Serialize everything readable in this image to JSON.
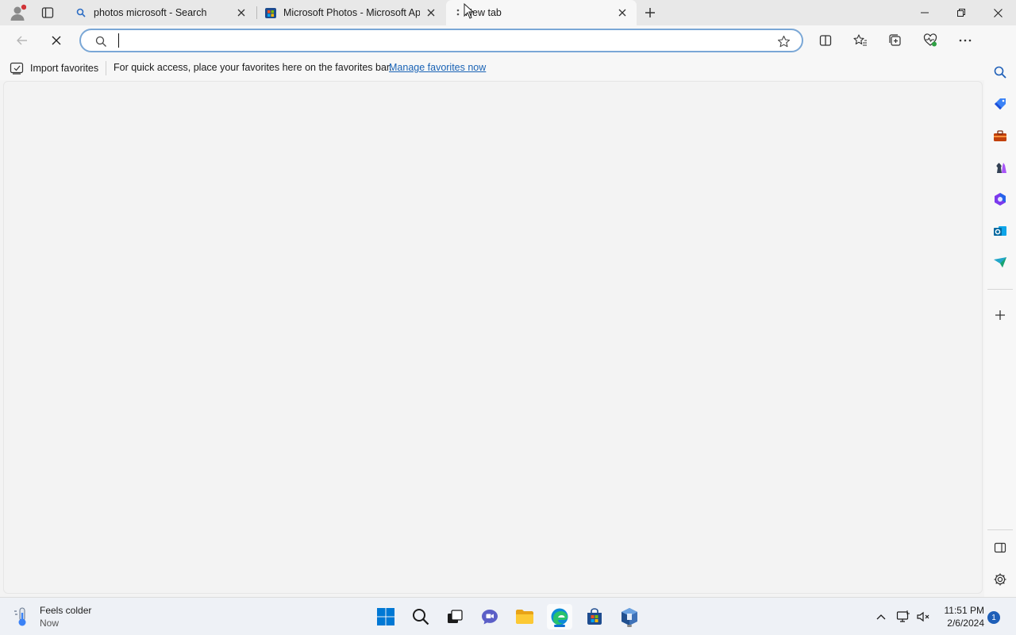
{
  "tabs": [
    {
      "title": "photos microsoft - Search",
      "icon": "search-icon"
    },
    {
      "title": "Microsoft Photos - Microsoft Apps",
      "icon": "store-icon"
    },
    {
      "title": "New tab",
      "icon": "loading-icon",
      "active": true
    }
  ],
  "address_bar": {
    "value": "",
    "placeholder": ""
  },
  "favorites_bar": {
    "import_label": "Import favorites",
    "message": "For quick access, place your favorites here on the favorites bar.",
    "manage_link": "Manage favorites now"
  },
  "taskbar": {
    "weather_title": "Feels colder",
    "weather_sub": "Now",
    "time": "11:51 PM",
    "date": "2/6/2024",
    "notification_count": "1"
  },
  "colors": {
    "accent": "#1a63b5",
    "omnibox_border": "#7aa7d6",
    "profile_dot": "#d13438"
  }
}
